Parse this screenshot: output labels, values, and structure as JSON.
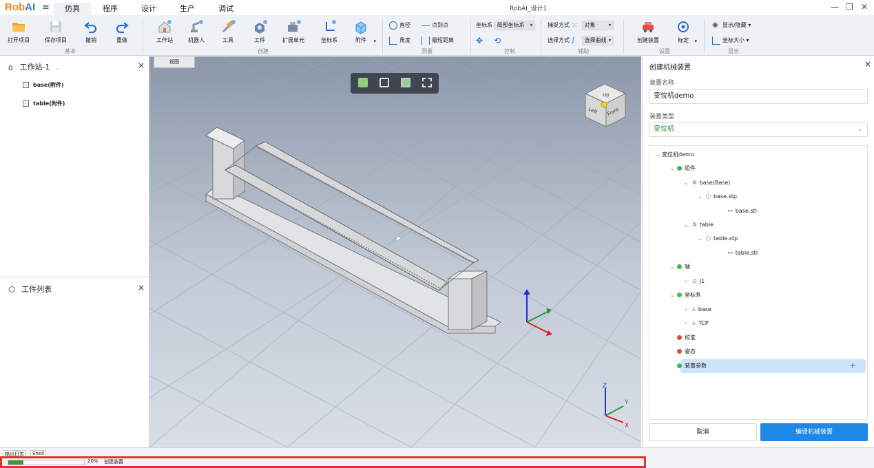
{
  "app": {
    "logo_a": "Rob",
    "logo_b": "AI",
    "window_title": "RobAI_设计1"
  },
  "menu_tabs": [
    "仿真",
    "程序",
    "设计",
    "生产",
    "调试"
  ],
  "ribbon": {
    "basic": {
      "items": [
        "打开项目",
        "保存项目",
        "撤销",
        "重做"
      ],
      "group": "基本"
    },
    "create": {
      "items": [
        "工作站",
        "机器人",
        "工具",
        "工件",
        "扩展单元",
        "坐标系",
        "附件"
      ],
      "group": "创建"
    },
    "measure": {
      "items": [
        "直径",
        "点到点",
        "角度",
        "最短距离"
      ],
      "group": "测量"
    },
    "control": {
      "label": "坐标系",
      "value": "局部坐标系",
      "group": "控制"
    },
    "assist": {
      "capture_label": "捕捉方式",
      "capture_value": "对象",
      "select_label": "选择方式",
      "select_value": "选择曲线",
      "group": "辅助"
    },
    "settings": {
      "items": [
        "创建装置",
        "标定"
      ],
      "group": "设置"
    },
    "display": {
      "items": [
        "显示/隐藏",
        "坐标大小"
      ],
      "group": "显示"
    }
  },
  "left_panel": {
    "station": "工作站-1",
    "items": [
      "base(附件)",
      "table(附件)"
    ],
    "workpiece_title": "工件列表"
  },
  "viewport": {
    "tab": "视图",
    "cube": {
      "top": "Up",
      "left": "Left",
      "right": "Front"
    },
    "axes": {
      "z": "Z",
      "y": "Y",
      "x": "X"
    }
  },
  "right_panel": {
    "title": "创建机械装置",
    "name_label": "装置名称",
    "name_value": "变位机demo",
    "type_label": "装置类型",
    "type_value": "变位机",
    "tree": {
      "root": "变位机demo",
      "group_components": "组件",
      "base": "base(Base)",
      "base_stp": "base.stp",
      "base_stl": "base.stl",
      "table": "table",
      "table_stp": "table.stp",
      "table_stl": "table.stl",
      "group_axes": "轴",
      "axis_j1": "J1",
      "group_frames": "坐标系",
      "frame_base": "base",
      "frame_tcp": "TCP",
      "calibration": "校准",
      "pose": "姿态",
      "params": "装置参数"
    },
    "cancel": "取消",
    "compile": "编译机械装置"
  },
  "bottom": {
    "tabs": [
      "输出日志",
      "Shell"
    ],
    "progress": 0.2,
    "progress_text": "20%",
    "status": "创建装置"
  },
  "colors": {
    "accent": "#1e88e5",
    "logo_orange": "#e8891c",
    "logo_blue": "#3a7bd5",
    "highlight": "#e04a3a"
  }
}
